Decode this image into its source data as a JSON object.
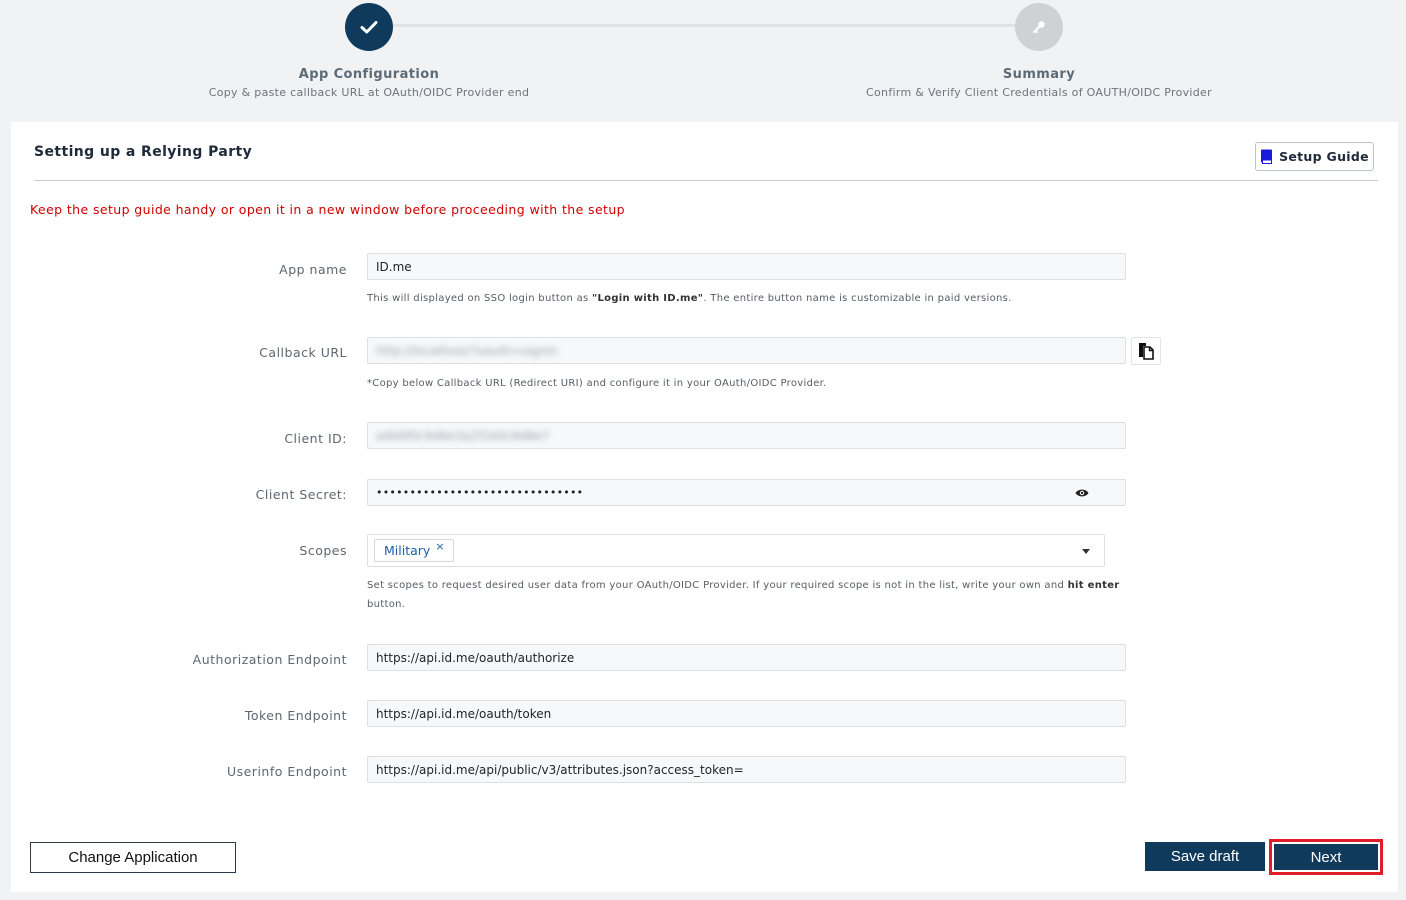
{
  "stepper": {
    "steps": [
      {
        "title": "App Configuration",
        "description": "Copy & paste callback URL at OAuth/OIDC Provider end",
        "status": "complete",
        "icon": "check-icon"
      },
      {
        "title": "Summary",
        "description": "Confirm & Verify Client Credentials of OAUTH/OIDC Provider",
        "status": "pending",
        "icon": "key-icon"
      }
    ]
  },
  "card": {
    "title": "Setting up a Relying Party",
    "setup_guide_label": "Setup Guide",
    "warning": "Keep the setup guide handy or open it in a new window before proceeding with the setup"
  },
  "form": {
    "app_name": {
      "label": "App name",
      "value": "ID.me",
      "help_prefix": "This will displayed on SSO login button as ",
      "help_bold": "\"Login with ID.me\"",
      "help_suffix": ". The entire button name is customizable in paid versions."
    },
    "callback_url": {
      "label": "Callback URL",
      "value": "http://localhost/?oauth=signin",
      "help": "*Copy below Callback URL (Redirect URI) and configure it in your OAuth/OIDC Provider."
    },
    "client_id": {
      "label": "Client ID:",
      "value": "a4b6f0c9d6e3a2f1b0c9d8e7"
    },
    "client_secret": {
      "label": "Client Secret:",
      "value": "•••••••••••••••••••••••••••••••"
    },
    "scopes": {
      "label": "Scopes",
      "selected": [
        "Military"
      ],
      "remove_glyph": "×",
      "help_prefix": "Set scopes to request desired user data from your OAuth/OIDC Provider. If your required scope is not in the list, write your own and ",
      "help_bold": "hit enter",
      "help_suffix": " button."
    },
    "authorization_endpoint": {
      "label": "Authorization Endpoint",
      "value": "https://api.id.me/oauth/authorize"
    },
    "token_endpoint": {
      "label": "Token Endpoint",
      "value": "https://api.id.me/oauth/token"
    },
    "userinfo_endpoint": {
      "label": "Userinfo Endpoint",
      "value": "https://api.id.me/api/public/v3/attributes.json?access_token="
    }
  },
  "footer": {
    "change_application_label": "Change Application",
    "save_draft_label": "Save draft",
    "next_label": "Next"
  },
  "colors": {
    "primary": "#0f3a5c",
    "warning_text": "#d10000",
    "highlight_border": "#e01e2b",
    "scope_tag_text": "#1f5ea8"
  }
}
